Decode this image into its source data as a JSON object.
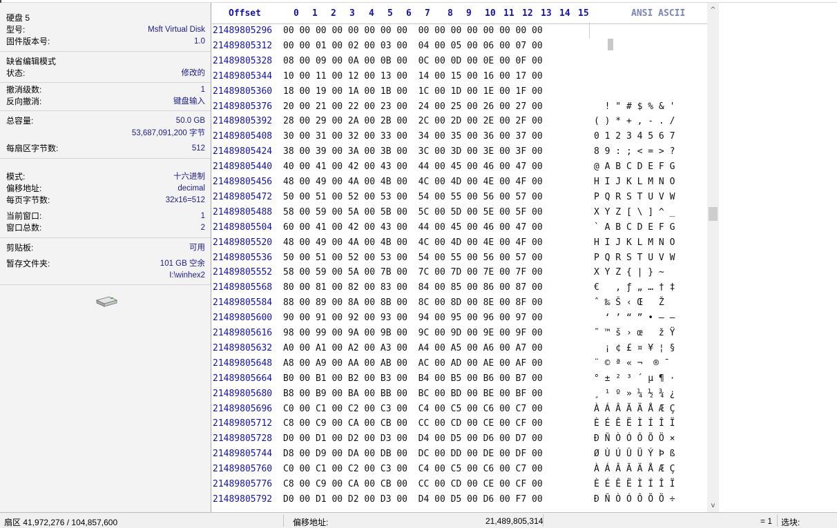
{
  "disk_info": {
    "disk_name": "硬盘 5",
    "model_label": "型号:",
    "model_value": "Msft Virtual Disk",
    "firmware_label": "固件版本号:",
    "firmware_value": "1.0",
    "edit_mode_label": "缺省编辑模式",
    "state_label": "状态:",
    "state_value": "修改的",
    "undo_level_label": "撤消级数:",
    "undo_level_value": "1",
    "reverse_undo_label": "反向撤消:",
    "reverse_undo_value": "键盘输入",
    "capacity_label": "总容量:",
    "capacity_gb": "50.0 GB",
    "capacity_bytes": "53,687,091,200 字节",
    "bytes_per_sector_label": "每扇区字节数:",
    "bytes_per_sector_value": "512",
    "mode_label": "模式:",
    "mode_value": "十六进制",
    "offset_label": "偏移地址:",
    "offset_value": "decimal",
    "bytes_per_page_label": "每页字节数:",
    "bytes_per_page_value": "32x16=512",
    "current_window_label": "当前窗口:",
    "current_window_value": "1",
    "window_count_label": "窗口总数:",
    "window_count_value": "2",
    "clipboard_label": "剪贴板:",
    "clipboard_value": "可用",
    "temp_folder_label": "暂存文件夹:",
    "temp_folder_free": "101 GB 空余",
    "temp_folder_path": "I:\\winhex2",
    "icon": "disk-drive-icon"
  },
  "hex_view": {
    "offset_header": "Offset",
    "ansi_header": "ANSI ASCII",
    "columns": [
      "0",
      "1",
      "2",
      "3",
      "4",
      "5",
      "6",
      "7",
      "8",
      "9",
      "10",
      "11",
      "12",
      "13",
      "14",
      "15"
    ],
    "rows": [
      {
        "offset": "21489805296",
        "bytes": "00 00 00 00 00 00 00 00  00 00 00 00 00 00 00 00",
        "ascii": ""
      },
      {
        "offset": "21489805312",
        "bytes": "00 00 01 00 02 00 03 00  04 00 05 00 06 00 07 00",
        "ascii": ""
      },
      {
        "offset": "21489805328",
        "bytes": "08 00 09 00 0A 00 0B 00  0C 00 0D 00 0E 00 0F 00",
        "ascii": ""
      },
      {
        "offset": "21489805344",
        "bytes": "10 00 11 00 12 00 13 00  14 00 15 00 16 00 17 00",
        "ascii": ""
      },
      {
        "offset": "21489805360",
        "bytes": "18 00 19 00 1A 00 1B 00  1C 00 1D 00 1E 00 1F 00",
        "ascii": ""
      },
      {
        "offset": "21489805376",
        "bytes": "20 00 21 00 22 00 23 00  24 00 25 00 26 00 27 00",
        "ascii": "  ! \" # $ % & '"
      },
      {
        "offset": "21489805392",
        "bytes": "28 00 29 00 2A 00 2B 00  2C 00 2D 00 2E 00 2F 00",
        "ascii": "( ) * + , - . /"
      },
      {
        "offset": "21489805408",
        "bytes": "30 00 31 00 32 00 33 00  34 00 35 00 36 00 37 00",
        "ascii": "0 1 2 3 4 5 6 7"
      },
      {
        "offset": "21489805424",
        "bytes": "38 00 39 00 3A 00 3B 00  3C 00 3D 00 3E 00 3F 00",
        "ascii": "8 9 : ; < = > ?"
      },
      {
        "offset": "21489805440",
        "bytes": "40 00 41 00 42 00 43 00  44 00 45 00 46 00 47 00",
        "ascii": "@ A B C D E F G"
      },
      {
        "offset": "21489805456",
        "bytes": "48 00 49 00 4A 00 4B 00  4C 00 4D 00 4E 00 4F 00",
        "ascii": "H I J K L M N O"
      },
      {
        "offset": "21489805472",
        "bytes": "50 00 51 00 52 00 53 00  54 00 55 00 56 00 57 00",
        "ascii": "P Q R S T U V W"
      },
      {
        "offset": "21489805488",
        "bytes": "58 00 59 00 5A 00 5B 00  5C 00 5D 00 5E 00 5F 00",
        "ascii": "X Y Z [ \\ ] ^ _"
      },
      {
        "offset": "21489805504",
        "bytes": "60 00 41 00 42 00 43 00  44 00 45 00 46 00 47 00",
        "ascii": "` A B C D E F G"
      },
      {
        "offset": "21489805520",
        "bytes": "48 00 49 00 4A 00 4B 00  4C 00 4D 00 4E 00 4F 00",
        "ascii": "H I J K L M N O"
      },
      {
        "offset": "21489805536",
        "bytes": "50 00 51 00 52 00 53 00  54 00 55 00 56 00 57 00",
        "ascii": "P Q R S T U V W"
      },
      {
        "offset": "21489805552",
        "bytes": "58 00 59 00 5A 00 7B 00  7C 00 7D 00 7E 00 7F 00",
        "ascii": "X Y Z { | } ~"
      },
      {
        "offset": "21489805568",
        "bytes": "80 00 81 00 82 00 83 00  84 00 85 00 86 00 87 00",
        "ascii": "€   ‚ ƒ „ … † ‡"
      },
      {
        "offset": "21489805584",
        "bytes": "88 00 89 00 8A 00 8B 00  8C 00 8D 00 8E 00 8F 00",
        "ascii": "ˆ ‰ Š ‹ Œ   Ž"
      },
      {
        "offset": "21489805600",
        "bytes": "90 00 91 00 92 00 93 00  94 00 95 00 96 00 97 00",
        "ascii": "  ‘ ’ “ ” • – —"
      },
      {
        "offset": "21489805616",
        "bytes": "98 00 99 00 9A 00 9B 00  9C 00 9D 00 9E 00 9F 00",
        "ascii": "˜ ™ š › œ   ž Ÿ"
      },
      {
        "offset": "21489805632",
        "bytes": "A0 00 A1 00 A2 00 A3 00  A4 00 A5 00 A6 00 A7 00",
        "ascii": "  ¡ ¢ £ ¤ ¥ ¦ §"
      },
      {
        "offset": "21489805648",
        "bytes": "A8 00 A9 00 AA 00 AB 00  AC 00 AD 00 AE 00 AF 00",
        "ascii": "¨ © ª « ¬ ­ ® ¯"
      },
      {
        "offset": "21489805664",
        "bytes": "B0 00 B1 00 B2 00 B3 00  B4 00 B5 00 B6 00 B7 00",
        "ascii": "° ± ² ³ ´ µ ¶ ·"
      },
      {
        "offset": "21489805680",
        "bytes": "B8 00 B9 00 BA 00 BB 00  BC 00 BD 00 BE 00 BF 00",
        "ascii": "¸ ¹ º » ¼ ½ ¾ ¿"
      },
      {
        "offset": "21489805696",
        "bytes": "C0 00 C1 00 C2 00 C3 00  C4 00 C5 00 C6 00 C7 00",
        "ascii": "À Á Â Ã Ä Å Æ Ç"
      },
      {
        "offset": "21489805712",
        "bytes": "C8 00 C9 00 CA 00 CB 00  CC 00 CD 00 CE 00 CF 00",
        "ascii": "È É Ê Ë Ì Í Î Ï"
      },
      {
        "offset": "21489805728",
        "bytes": "D0 00 D1 00 D2 00 D3 00  D4 00 D5 00 D6 00 D7 00",
        "ascii": "Ð Ñ Ò Ó Ô Õ Ö ×"
      },
      {
        "offset": "21489805744",
        "bytes": "D8 00 D9 00 DA 00 DB 00  DC 00 DD 00 DE 00 DF 00",
        "ascii": "Ø Ù Ú Û Ü Ý Þ ß"
      },
      {
        "offset": "21489805760",
        "bytes": "C0 00 C1 00 C2 00 C3 00  C4 00 C5 00 C6 00 C7 00",
        "ascii": "À Á Â Ã Ä Å Æ Ç"
      },
      {
        "offset": "21489805776",
        "bytes": "C8 00 C9 00 CA 00 CB 00  CC 00 CD 00 CE 00 CF 00",
        "ascii": "È É Ê Ë Ì Í Î Ï"
      },
      {
        "offset": "21489805792",
        "bytes": "D0 00 D1 00 D2 00 D3 00  D4 00 D5 00 D6 00 F7 00",
        "ascii": "Ð Ñ Ò Ó Ô Õ Ö ÷"
      }
    ]
  },
  "scrollbar": {
    "up_arrow": "^",
    "down_arrow": "v"
  },
  "status_bar": {
    "sector": "扇区 41,972,276 / 104,857,600",
    "offset_label": "偏移地址:",
    "offset_value": "21,489,805,314",
    "value_eq": "= 1",
    "block_label": "选块:"
  },
  "colors": {
    "offset_blue": "#1212b4",
    "ansi_header": "#7b84b6",
    "panel_bg": "#f3f3f3",
    "value_blue": "#1b1b8c"
  }
}
